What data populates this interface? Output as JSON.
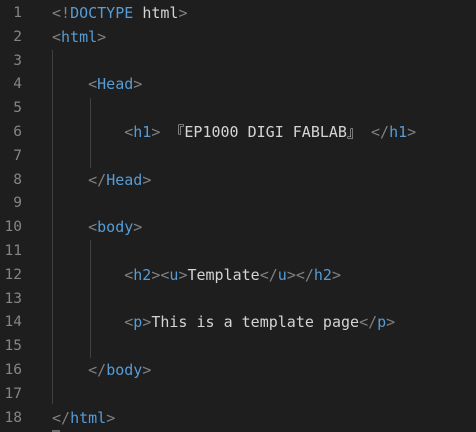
{
  "editor": {
    "lines": [
      {
        "num": "1",
        "segs": [
          {
            "t": "<!",
            "c": "p"
          },
          {
            "t": "DOCTYPE",
            "c": "t"
          },
          {
            "t": " ",
            "c": "x"
          },
          {
            "t": "html",
            "c": "x"
          },
          {
            "t": ">",
            "c": "p"
          }
        ]
      },
      {
        "num": "2",
        "segs": [
          {
            "t": "<",
            "c": "p"
          },
          {
            "t": "html",
            "c": "t"
          },
          {
            "t": ">",
            "c": "p"
          }
        ]
      },
      {
        "num": "3",
        "segs": []
      },
      {
        "num": "4",
        "segs": [
          {
            "t": "    ",
            "c": "x"
          },
          {
            "t": "<",
            "c": "p"
          },
          {
            "t": "Head",
            "c": "t"
          },
          {
            "t": ">",
            "c": "p"
          }
        ]
      },
      {
        "num": "5",
        "segs": []
      },
      {
        "num": "6",
        "segs": [
          {
            "t": "        ",
            "c": "x"
          },
          {
            "t": "<",
            "c": "p"
          },
          {
            "t": "h1",
            "c": "t"
          },
          {
            "t": ">",
            "c": "p"
          },
          {
            "t": " 『EP1000 DIGI FABLAB』 ",
            "c": "x"
          },
          {
            "t": "</",
            "c": "p"
          },
          {
            "t": "h1",
            "c": "t"
          },
          {
            "t": ">",
            "c": "p"
          }
        ]
      },
      {
        "num": "7",
        "segs": []
      },
      {
        "num": "8",
        "segs": [
          {
            "t": "    ",
            "c": "x"
          },
          {
            "t": "</",
            "c": "p"
          },
          {
            "t": "Head",
            "c": "t"
          },
          {
            "t": ">",
            "c": "p"
          }
        ]
      },
      {
        "num": "9",
        "segs": []
      },
      {
        "num": "10",
        "segs": [
          {
            "t": "    ",
            "c": "x"
          },
          {
            "t": "<",
            "c": "p"
          },
          {
            "t": "body",
            "c": "t"
          },
          {
            "t": ">",
            "c": "p"
          }
        ]
      },
      {
        "num": "11",
        "segs": []
      },
      {
        "num": "12",
        "segs": [
          {
            "t": "        ",
            "c": "x"
          },
          {
            "t": "<",
            "c": "p"
          },
          {
            "t": "h2",
            "c": "t"
          },
          {
            "t": ">",
            "c": "p"
          },
          {
            "t": "<",
            "c": "p"
          },
          {
            "t": "u",
            "c": "t"
          },
          {
            "t": ">",
            "c": "p"
          },
          {
            "t": "Template",
            "c": "x"
          },
          {
            "t": "</",
            "c": "p"
          },
          {
            "t": "u",
            "c": "t"
          },
          {
            "t": ">",
            "c": "p"
          },
          {
            "t": "</",
            "c": "p"
          },
          {
            "t": "h2",
            "c": "t"
          },
          {
            "t": ">",
            "c": "p"
          }
        ]
      },
      {
        "num": "13",
        "segs": []
      },
      {
        "num": "14",
        "segs": [
          {
            "t": "        ",
            "c": "x"
          },
          {
            "t": "<",
            "c": "p"
          },
          {
            "t": "p",
            "c": "t"
          },
          {
            "t": ">",
            "c": "p"
          },
          {
            "t": "This is a template page",
            "c": "x"
          },
          {
            "t": "</",
            "c": "p"
          },
          {
            "t": "p",
            "c": "t"
          },
          {
            "t": ">",
            "c": "p"
          }
        ]
      },
      {
        "num": "15",
        "segs": []
      },
      {
        "num": "16",
        "segs": [
          {
            "t": "    ",
            "c": "x"
          },
          {
            "t": "</",
            "c": "p"
          },
          {
            "t": "body",
            "c": "t"
          },
          {
            "t": ">",
            "c": "p"
          }
        ]
      },
      {
        "num": "17",
        "segs": []
      },
      {
        "num": "18",
        "segs": [
          {
            "t": "</",
            "c": "p"
          },
          {
            "t": "html",
            "c": "t"
          },
          {
            "t": ">",
            "c": "p"
          }
        ]
      }
    ]
  },
  "colors": {
    "background": "#1e1e1e",
    "punctuation": "#808080",
    "tag": "#569cd6",
    "text": "#d4d4d4",
    "line_number": "#858585"
  }
}
